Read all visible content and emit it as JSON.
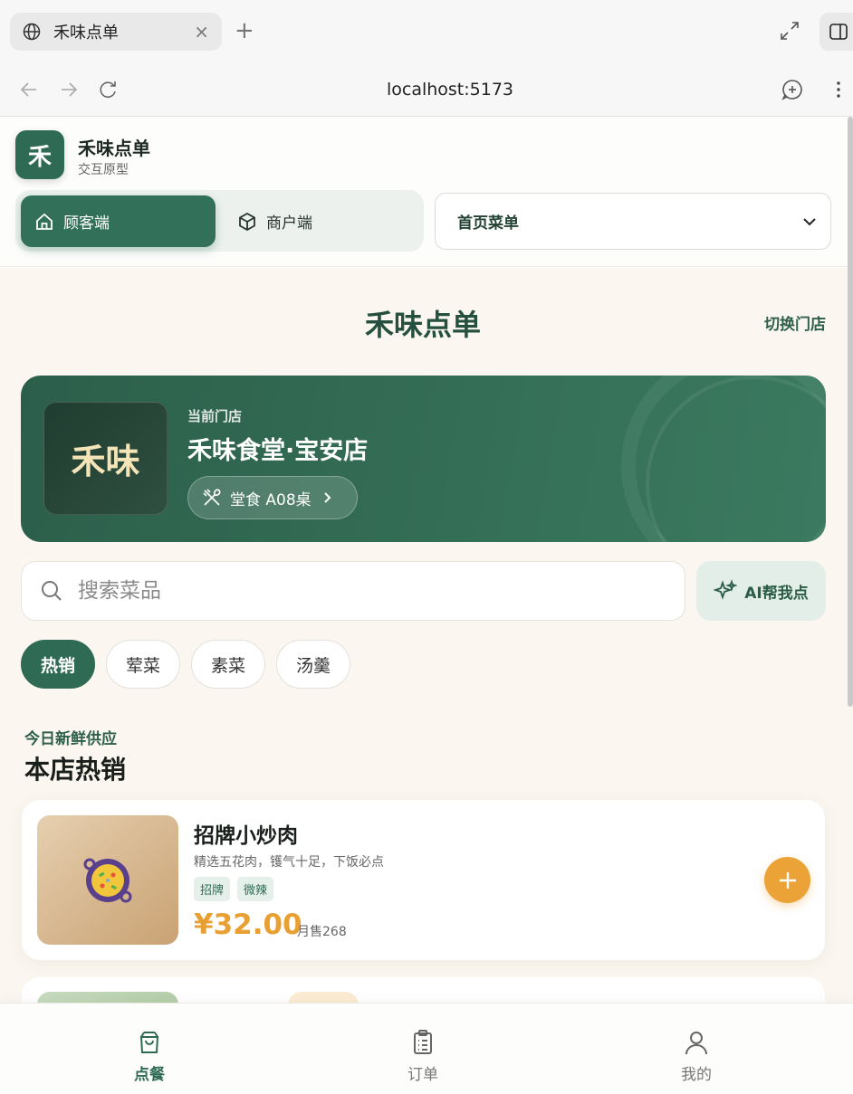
{
  "browser": {
    "tab_title": "禾味点单",
    "tab_close": "×",
    "new_tab": "+",
    "url": "localhost:5173"
  },
  "header": {
    "logo_char": "禾",
    "brand_name": "禾味点单",
    "brand_sub": "交互原型",
    "segments": [
      {
        "label": "顾客端",
        "icon": "home-icon",
        "active": true
      },
      {
        "label": "商户端",
        "icon": "box-icon",
        "active": false
      }
    ],
    "page_select_value": "首页菜单"
  },
  "main": {
    "page_title": "禾味点单",
    "switch_store": "切换门店",
    "store": {
      "logo_text": "禾味",
      "label": "当前门店",
      "name": "禾味食堂·宝安店",
      "table_text": "堂食 A08桌"
    },
    "search_placeholder": "搜索菜品",
    "ai_label": "AI帮我点",
    "categories": [
      "热销",
      "荤菜",
      "素菜",
      "汤羹"
    ],
    "active_category": "热销",
    "section_sub": "今日新鲜供应",
    "section_title": "本店热销",
    "dishes": [
      {
        "name": "招牌小炒肉",
        "desc": "精选五花肉，镬气十足，下饭必点",
        "tags": [
          "招牌",
          "微辣"
        ],
        "price": "¥32.00",
        "sold": "月售268",
        "icon": "paella-pan-icon"
      },
      {
        "name": "",
        "icon": "vegetable-dish-icon"
      }
    ]
  },
  "bottom_nav": [
    {
      "label": "点餐",
      "icon": "shopping-bag-icon",
      "active": true
    },
    {
      "label": "订单",
      "icon": "clipboard-icon",
      "active": false
    },
    {
      "label": "我的",
      "icon": "user-icon",
      "active": false
    }
  ],
  "colors": {
    "primary": "#2f6b54",
    "accent": "#eba237",
    "background": "#fbf7f0"
  }
}
